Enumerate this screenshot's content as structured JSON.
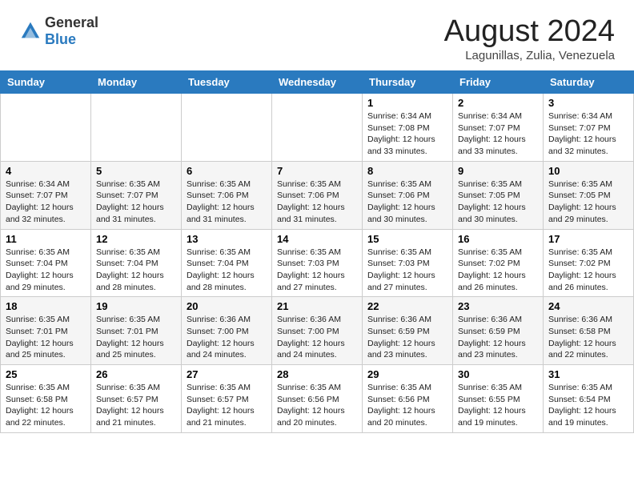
{
  "header": {
    "logo_general": "General",
    "logo_blue": "Blue",
    "month_year": "August 2024",
    "location": "Lagunillas, Zulia, Venezuela"
  },
  "calendar": {
    "days_of_week": [
      "Sunday",
      "Monday",
      "Tuesday",
      "Wednesday",
      "Thursday",
      "Friday",
      "Saturday"
    ],
    "weeks": [
      [
        {
          "day": "",
          "info": ""
        },
        {
          "day": "",
          "info": ""
        },
        {
          "day": "",
          "info": ""
        },
        {
          "day": "",
          "info": ""
        },
        {
          "day": "1",
          "info": "Sunrise: 6:34 AM\nSunset: 7:08 PM\nDaylight: 12 hours\nand 33 minutes."
        },
        {
          "day": "2",
          "info": "Sunrise: 6:34 AM\nSunset: 7:07 PM\nDaylight: 12 hours\nand 33 minutes."
        },
        {
          "day": "3",
          "info": "Sunrise: 6:34 AM\nSunset: 7:07 PM\nDaylight: 12 hours\nand 32 minutes."
        }
      ],
      [
        {
          "day": "4",
          "info": "Sunrise: 6:34 AM\nSunset: 7:07 PM\nDaylight: 12 hours\nand 32 minutes."
        },
        {
          "day": "5",
          "info": "Sunrise: 6:35 AM\nSunset: 7:07 PM\nDaylight: 12 hours\nand 31 minutes."
        },
        {
          "day": "6",
          "info": "Sunrise: 6:35 AM\nSunset: 7:06 PM\nDaylight: 12 hours\nand 31 minutes."
        },
        {
          "day": "7",
          "info": "Sunrise: 6:35 AM\nSunset: 7:06 PM\nDaylight: 12 hours\nand 31 minutes."
        },
        {
          "day": "8",
          "info": "Sunrise: 6:35 AM\nSunset: 7:06 PM\nDaylight: 12 hours\nand 30 minutes."
        },
        {
          "day": "9",
          "info": "Sunrise: 6:35 AM\nSunset: 7:05 PM\nDaylight: 12 hours\nand 30 minutes."
        },
        {
          "day": "10",
          "info": "Sunrise: 6:35 AM\nSunset: 7:05 PM\nDaylight: 12 hours\nand 29 minutes."
        }
      ],
      [
        {
          "day": "11",
          "info": "Sunrise: 6:35 AM\nSunset: 7:04 PM\nDaylight: 12 hours\nand 29 minutes."
        },
        {
          "day": "12",
          "info": "Sunrise: 6:35 AM\nSunset: 7:04 PM\nDaylight: 12 hours\nand 28 minutes."
        },
        {
          "day": "13",
          "info": "Sunrise: 6:35 AM\nSunset: 7:04 PM\nDaylight: 12 hours\nand 28 minutes."
        },
        {
          "day": "14",
          "info": "Sunrise: 6:35 AM\nSunset: 7:03 PM\nDaylight: 12 hours\nand 27 minutes."
        },
        {
          "day": "15",
          "info": "Sunrise: 6:35 AM\nSunset: 7:03 PM\nDaylight: 12 hours\nand 27 minutes."
        },
        {
          "day": "16",
          "info": "Sunrise: 6:35 AM\nSunset: 7:02 PM\nDaylight: 12 hours\nand 26 minutes."
        },
        {
          "day": "17",
          "info": "Sunrise: 6:35 AM\nSunset: 7:02 PM\nDaylight: 12 hours\nand 26 minutes."
        }
      ],
      [
        {
          "day": "18",
          "info": "Sunrise: 6:35 AM\nSunset: 7:01 PM\nDaylight: 12 hours\nand 25 minutes."
        },
        {
          "day": "19",
          "info": "Sunrise: 6:35 AM\nSunset: 7:01 PM\nDaylight: 12 hours\nand 25 minutes."
        },
        {
          "day": "20",
          "info": "Sunrise: 6:36 AM\nSunset: 7:00 PM\nDaylight: 12 hours\nand 24 minutes."
        },
        {
          "day": "21",
          "info": "Sunrise: 6:36 AM\nSunset: 7:00 PM\nDaylight: 12 hours\nand 24 minutes."
        },
        {
          "day": "22",
          "info": "Sunrise: 6:36 AM\nSunset: 6:59 PM\nDaylight: 12 hours\nand 23 minutes."
        },
        {
          "day": "23",
          "info": "Sunrise: 6:36 AM\nSunset: 6:59 PM\nDaylight: 12 hours\nand 23 minutes."
        },
        {
          "day": "24",
          "info": "Sunrise: 6:36 AM\nSunset: 6:58 PM\nDaylight: 12 hours\nand 22 minutes."
        }
      ],
      [
        {
          "day": "25",
          "info": "Sunrise: 6:35 AM\nSunset: 6:58 PM\nDaylight: 12 hours\nand 22 minutes."
        },
        {
          "day": "26",
          "info": "Sunrise: 6:35 AM\nSunset: 6:57 PM\nDaylight: 12 hours\nand 21 minutes."
        },
        {
          "day": "27",
          "info": "Sunrise: 6:35 AM\nSunset: 6:57 PM\nDaylight: 12 hours\nand 21 minutes."
        },
        {
          "day": "28",
          "info": "Sunrise: 6:35 AM\nSunset: 6:56 PM\nDaylight: 12 hours\nand 20 minutes."
        },
        {
          "day": "29",
          "info": "Sunrise: 6:35 AM\nSunset: 6:56 PM\nDaylight: 12 hours\nand 20 minutes."
        },
        {
          "day": "30",
          "info": "Sunrise: 6:35 AM\nSunset: 6:55 PM\nDaylight: 12 hours\nand 19 minutes."
        },
        {
          "day": "31",
          "info": "Sunrise: 6:35 AM\nSunset: 6:54 PM\nDaylight: 12 hours\nand 19 minutes."
        }
      ]
    ]
  }
}
